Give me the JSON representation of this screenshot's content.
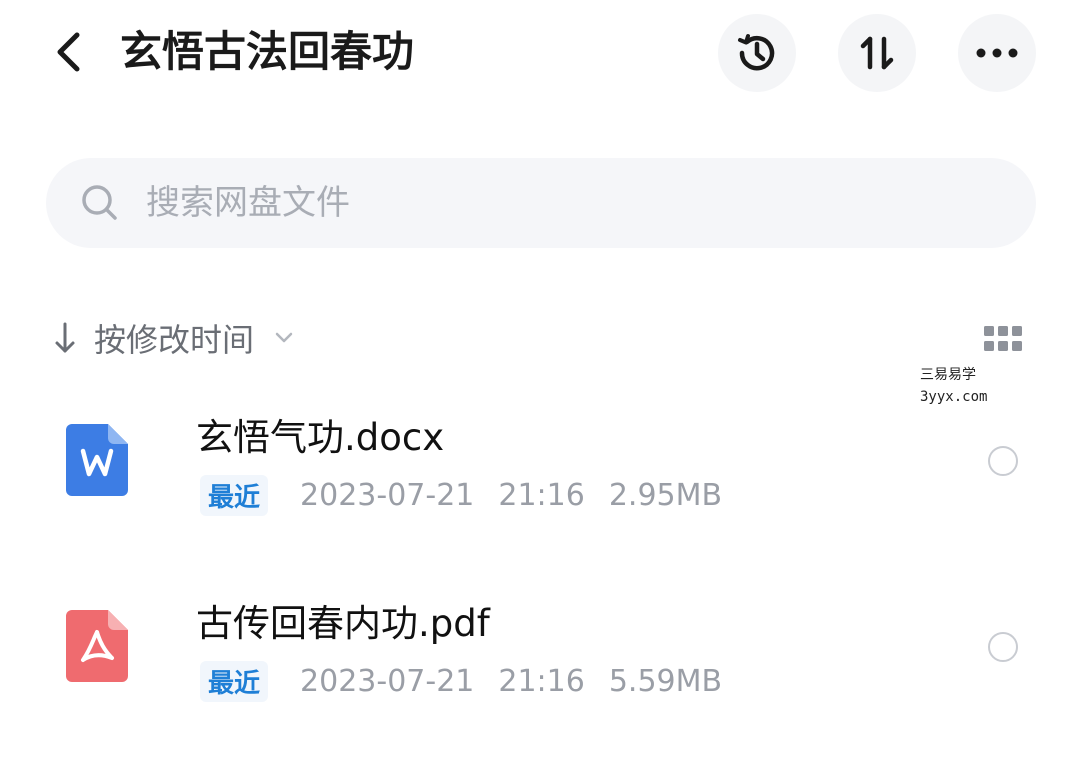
{
  "header": {
    "title": "玄悟古法回春功"
  },
  "search": {
    "placeholder": "搜索网盘文件"
  },
  "sort": {
    "label": "按修改时间"
  },
  "watermark": {
    "line1": "三易易学",
    "line2": "3yyx.com"
  },
  "files": [
    {
      "name": "玄悟气功.docx",
      "badge": "最近",
      "date": "2023-07-21",
      "time": "21:16",
      "size": "2.95MB",
      "icon": "word-file-icon",
      "color": "#3d7de4"
    },
    {
      "name": "古传回春内功.pdf",
      "badge": "最近",
      "date": "2023-07-21",
      "time": "21:16",
      "size": "5.59MB",
      "icon": "pdf-file-icon",
      "color": "#ef6b6f"
    }
  ],
  "colors": {
    "accent": "#1f7fd6",
    "muted_text": "#9a9ea6",
    "search_bg": "#f5f6f9"
  }
}
